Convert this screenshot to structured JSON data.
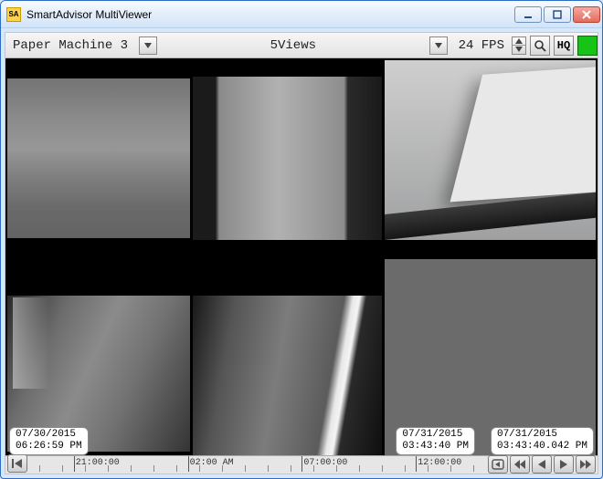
{
  "window": {
    "title": "SmartAdvisor MultiViewer"
  },
  "toolbar": {
    "machine_label": "Paper Machine 3",
    "views_label": "5Views",
    "fps_label": "24 FPS",
    "hq_label": "HQ"
  },
  "timeline": {
    "ticks": [
      {
        "pos_pct": 14,
        "label": "21:00:00",
        "major": true
      },
      {
        "pos_pct": 38,
        "label": "02:00 AM",
        "major": true
      },
      {
        "pos_pct": 62,
        "label": "07:00:00",
        "major": true
      },
      {
        "pos_pct": 86,
        "label": "12:00:00",
        "major": true
      }
    ]
  },
  "tags": {
    "start": {
      "date": "07/30/2015",
      "time": "06:26:59 PM"
    },
    "cursor": {
      "date": "07/31/2015",
      "time": "03:43:40 PM"
    },
    "end": {
      "date": "07/31/2015",
      "time": "03:43:40.042 PM"
    }
  },
  "icons": {
    "app": "SA"
  }
}
